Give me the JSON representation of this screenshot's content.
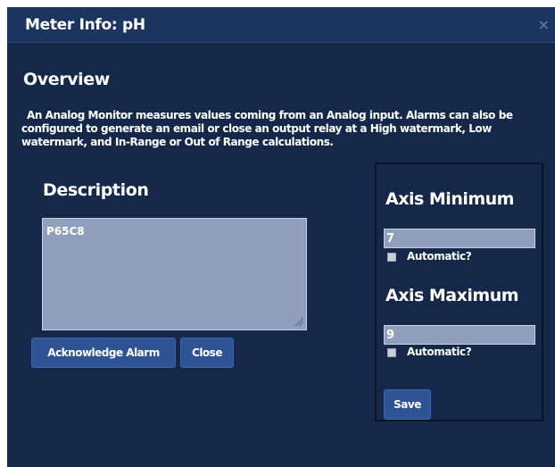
{
  "dialog": {
    "title": "Meter Info: pH",
    "close_glyph": "×"
  },
  "overview": {
    "heading": "Overview",
    "text": "An Analog Monitor measures values coming from an Analog input. Alarms can also be configured to generate an email or close an output relay at a High watermark, Low watermark, and In-Range or Out of Range calculations."
  },
  "description": {
    "heading": "Description",
    "value": "P65C8"
  },
  "buttons": {
    "acknowledge_label": "Acknowledge Alarm",
    "close_label": "Close",
    "save_label": "Save"
  },
  "axis": {
    "minimum": {
      "heading": "Axis Minimum",
      "value": "7",
      "automatic_label": "Automatic?",
      "automatic_checked": false
    },
    "maximum": {
      "heading": "Axis Maximum",
      "value": "9",
      "automatic_label": "Automatic?",
      "automatic_checked": false
    }
  },
  "colors": {
    "dialog_background": "#15284a",
    "titlebar_background": "#1b3460",
    "button_background": "#2e5496",
    "input_background": "#8f9fbc"
  },
  "icons": {
    "close": "close-icon",
    "resize": "resize-grip-icon"
  }
}
